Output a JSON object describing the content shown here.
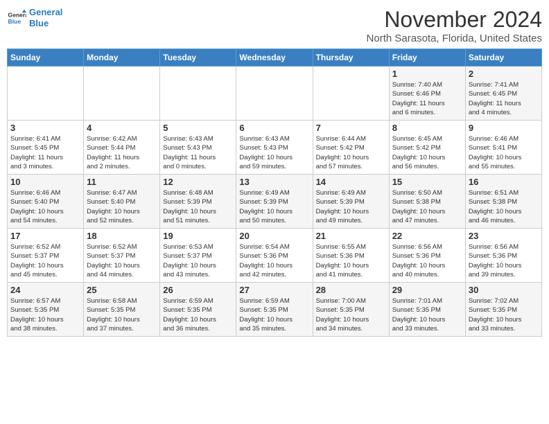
{
  "header": {
    "logo_line1": "General",
    "logo_line2": "Blue",
    "month": "November 2024",
    "location": "North Sarasota, Florida, United States"
  },
  "weekdays": [
    "Sunday",
    "Monday",
    "Tuesday",
    "Wednesday",
    "Thursday",
    "Friday",
    "Saturday"
  ],
  "weeks": [
    [
      {
        "day": "",
        "info": ""
      },
      {
        "day": "",
        "info": ""
      },
      {
        "day": "",
        "info": ""
      },
      {
        "day": "",
        "info": ""
      },
      {
        "day": "",
        "info": ""
      },
      {
        "day": "1",
        "info": "Sunrise: 7:40 AM\nSunset: 6:46 PM\nDaylight: 11 hours\nand 6 minutes."
      },
      {
        "day": "2",
        "info": "Sunrise: 7:41 AM\nSunset: 6:45 PM\nDaylight: 11 hours\nand 4 minutes."
      }
    ],
    [
      {
        "day": "3",
        "info": "Sunrise: 6:41 AM\nSunset: 5:45 PM\nDaylight: 11 hours\nand 3 minutes."
      },
      {
        "day": "4",
        "info": "Sunrise: 6:42 AM\nSunset: 5:44 PM\nDaylight: 11 hours\nand 2 minutes."
      },
      {
        "day": "5",
        "info": "Sunrise: 6:43 AM\nSunset: 5:43 PM\nDaylight: 11 hours\nand 0 minutes."
      },
      {
        "day": "6",
        "info": "Sunrise: 6:43 AM\nSunset: 5:43 PM\nDaylight: 10 hours\nand 59 minutes."
      },
      {
        "day": "7",
        "info": "Sunrise: 6:44 AM\nSunset: 5:42 PM\nDaylight: 10 hours\nand 57 minutes."
      },
      {
        "day": "8",
        "info": "Sunrise: 6:45 AM\nSunset: 5:42 PM\nDaylight: 10 hours\nand 56 minutes."
      },
      {
        "day": "9",
        "info": "Sunrise: 6:46 AM\nSunset: 5:41 PM\nDaylight: 10 hours\nand 55 minutes."
      }
    ],
    [
      {
        "day": "10",
        "info": "Sunrise: 6:46 AM\nSunset: 5:40 PM\nDaylight: 10 hours\nand 54 minutes."
      },
      {
        "day": "11",
        "info": "Sunrise: 6:47 AM\nSunset: 5:40 PM\nDaylight: 10 hours\nand 52 minutes."
      },
      {
        "day": "12",
        "info": "Sunrise: 6:48 AM\nSunset: 5:39 PM\nDaylight: 10 hours\nand 51 minutes."
      },
      {
        "day": "13",
        "info": "Sunrise: 6:49 AM\nSunset: 5:39 PM\nDaylight: 10 hours\nand 50 minutes."
      },
      {
        "day": "14",
        "info": "Sunrise: 6:49 AM\nSunset: 5:39 PM\nDaylight: 10 hours\nand 49 minutes."
      },
      {
        "day": "15",
        "info": "Sunrise: 6:50 AM\nSunset: 5:38 PM\nDaylight: 10 hours\nand 47 minutes."
      },
      {
        "day": "16",
        "info": "Sunrise: 6:51 AM\nSunset: 5:38 PM\nDaylight: 10 hours\nand 46 minutes."
      }
    ],
    [
      {
        "day": "17",
        "info": "Sunrise: 6:52 AM\nSunset: 5:37 PM\nDaylight: 10 hours\nand 45 minutes."
      },
      {
        "day": "18",
        "info": "Sunrise: 6:52 AM\nSunset: 5:37 PM\nDaylight: 10 hours\nand 44 minutes."
      },
      {
        "day": "19",
        "info": "Sunrise: 6:53 AM\nSunset: 5:37 PM\nDaylight: 10 hours\nand 43 minutes."
      },
      {
        "day": "20",
        "info": "Sunrise: 6:54 AM\nSunset: 5:36 PM\nDaylight: 10 hours\nand 42 minutes."
      },
      {
        "day": "21",
        "info": "Sunrise: 6:55 AM\nSunset: 5:36 PM\nDaylight: 10 hours\nand 41 minutes."
      },
      {
        "day": "22",
        "info": "Sunrise: 6:56 AM\nSunset: 5:36 PM\nDaylight: 10 hours\nand 40 minutes."
      },
      {
        "day": "23",
        "info": "Sunrise: 6:56 AM\nSunset: 5:36 PM\nDaylight: 10 hours\nand 39 minutes."
      }
    ],
    [
      {
        "day": "24",
        "info": "Sunrise: 6:57 AM\nSunset: 5:35 PM\nDaylight: 10 hours\nand 38 minutes."
      },
      {
        "day": "25",
        "info": "Sunrise: 6:58 AM\nSunset: 5:35 PM\nDaylight: 10 hours\nand 37 minutes."
      },
      {
        "day": "26",
        "info": "Sunrise: 6:59 AM\nSunset: 5:35 PM\nDaylight: 10 hours\nand 36 minutes."
      },
      {
        "day": "27",
        "info": "Sunrise: 6:59 AM\nSunset: 5:35 PM\nDaylight: 10 hours\nand 35 minutes."
      },
      {
        "day": "28",
        "info": "Sunrise: 7:00 AM\nSunset: 5:35 PM\nDaylight: 10 hours\nand 34 minutes."
      },
      {
        "day": "29",
        "info": "Sunrise: 7:01 AM\nSunset: 5:35 PM\nDaylight: 10 hours\nand 33 minutes."
      },
      {
        "day": "30",
        "info": "Sunrise: 7:02 AM\nSunset: 5:35 PM\nDaylight: 10 hours\nand 33 minutes."
      }
    ]
  ]
}
